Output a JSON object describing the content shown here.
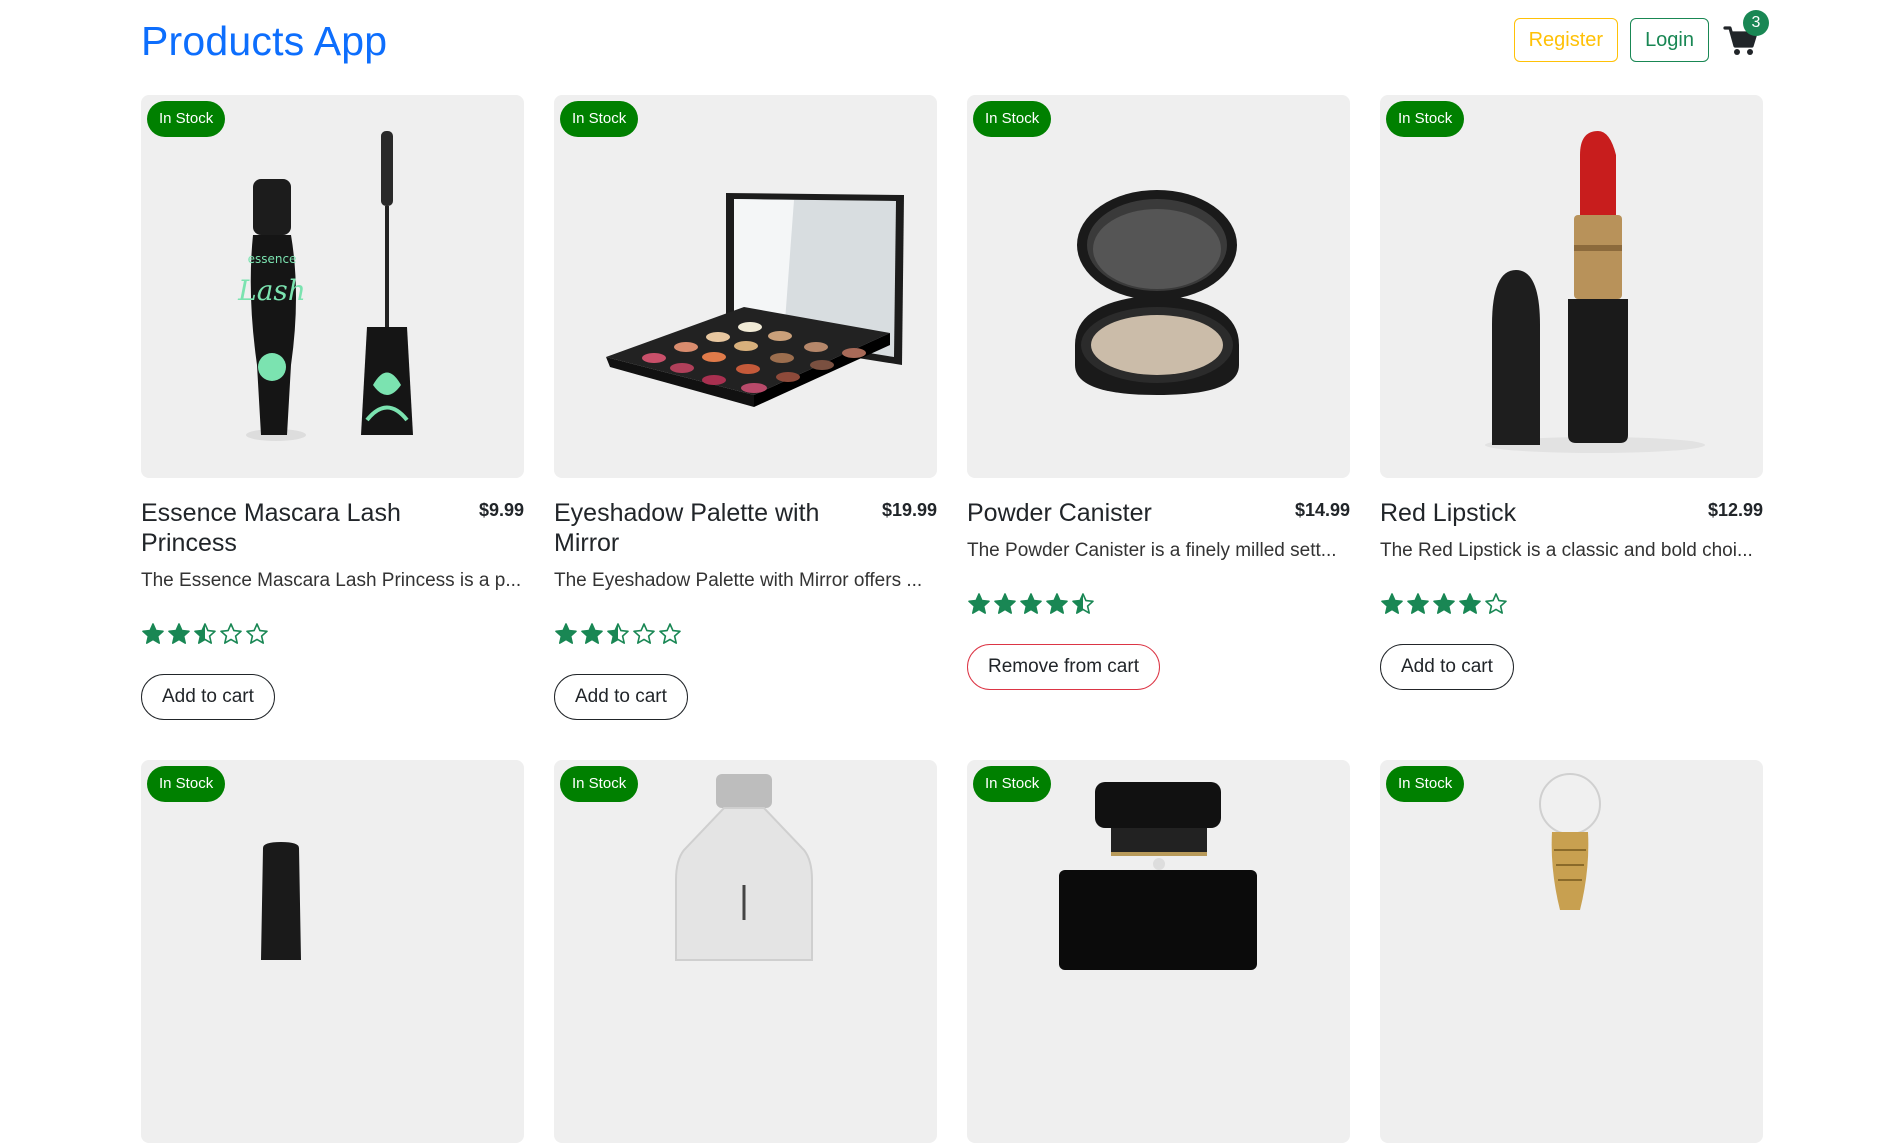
{
  "header": {
    "brand": "Products App",
    "register_label": "Register",
    "login_label": "Login",
    "cart_count": "3"
  },
  "colors": {
    "brand": "#0d6efd",
    "register": "#ffc107",
    "login": "#198754",
    "stock_badge": "#008000",
    "star": "#198754",
    "remove_border": "#dc3545"
  },
  "products": [
    {
      "badge": "In Stock",
      "title": "Essence Mascara Lash Princess",
      "price": "$9.99",
      "description": "The Essence Mascara Lash Princess is a p...",
      "rating": 2.5,
      "button": "Add to cart",
      "in_cart": false
    },
    {
      "badge": "In Stock",
      "title": "Eyeshadow Palette with Mirror",
      "price": "$19.99",
      "description": "The Eyeshadow Palette with Mirror offers ...",
      "rating": 2.5,
      "button": "Add to cart",
      "in_cart": false
    },
    {
      "badge": "In Stock",
      "title": "Powder Canister",
      "price": "$14.99",
      "description": "The Powder Canister is a finely milled sett...",
      "rating": 4.5,
      "button": "Remove from cart",
      "in_cart": true
    },
    {
      "badge": "In Stock",
      "title": "Red Lipstick",
      "price": "$12.99",
      "description": "The Red Lipstick is a classic and bold choi...",
      "rating": 4,
      "button": "Add to cart",
      "in_cart": false
    },
    {
      "badge": "In Stock"
    },
    {
      "badge": "In Stock"
    },
    {
      "badge": "In Stock"
    },
    {
      "badge": "In Stock"
    }
  ]
}
